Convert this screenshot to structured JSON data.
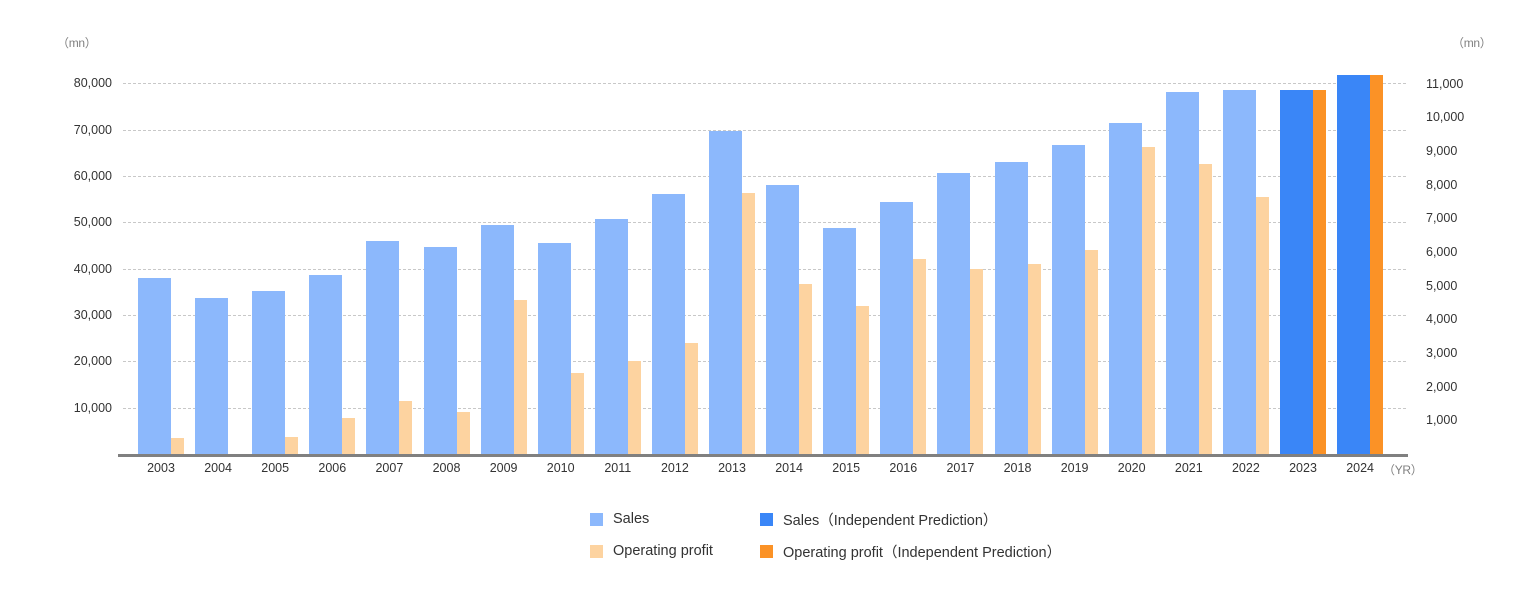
{
  "axes": {
    "left_unit": "（mn）",
    "right_unit": "（mn）",
    "x_unit": "（YR）",
    "left_ticks": [
      "80,000",
      "70,000",
      "60,000",
      "50,000",
      "40,000",
      "30,000",
      "20,000",
      "10,000"
    ],
    "right_ticks": [
      "11,000",
      "10,000",
      "9,000",
      "8,000",
      "7,000",
      "6,000",
      "5,000",
      "4,000",
      "3,000",
      "2,000",
      "1,000"
    ]
  },
  "legend": {
    "sales": "Sales",
    "sales_prediction": "Sales（Independent Prediction）",
    "operating_profit": "Operating profit",
    "operating_profit_prediction": "Operating profit（Independent Prediction）",
    "colors": {
      "sales": "#8cb8fc",
      "sales_prediction": "#3a86f7",
      "operating_profit": "#fdd3a0",
      "operating_profit_prediction": "#fb9226"
    }
  },
  "chart_data": {
    "type": "bar",
    "title": "",
    "xlabel": "（YR）",
    "ylabel": "（mn）",
    "y2label": "（mn）",
    "ylim": [
      0,
      85000
    ],
    "y2lim": [
      0,
      11700
    ],
    "grid": true,
    "legend_position": "bottom",
    "categories": [
      "2003",
      "2004",
      "2005",
      "2006",
      "2007",
      "2008",
      "2009",
      "2010",
      "2011",
      "2012",
      "2013",
      "2014",
      "2015",
      "2016",
      "2017",
      "2018",
      "2019",
      "2020",
      "2021",
      "2022",
      "2023",
      "2024"
    ],
    "series": [
      {
        "name": "Sales",
        "axis": "left",
        "unit": "mn",
        "values": [
          38000,
          33600,
          35100,
          38700,
          45900,
          44700,
          49500,
          45600,
          50700,
          56100,
          69700,
          58000,
          48700,
          54400,
          60600,
          62900,
          66700,
          71400,
          78100,
          78500,
          78500,
          81700
        ],
        "predicted_from": "2023"
      },
      {
        "name": "Operating profit",
        "axis": "right",
        "unit": "mn",
        "values": [
          480,
          0,
          510,
          1060,
          1580,
          1240,
          4560,
          2410,
          2760,
          3290,
          7750,
          5050,
          4400,
          5780,
          5500,
          5650,
          6060,
          9130,
          8620,
          7620,
          10800,
          11250
        ],
        "predicted_from": "2023"
      }
    ],
    "notes": "2004 operating profit not visible (≈0). 2023 and 2024 are independent predictions shown in saturated blue/orange."
  },
  "bars": [
    {
      "year": "2003",
      "sales": 38000,
      "profit": 480,
      "predicted": false
    },
    {
      "year": "2004",
      "sales": 33600,
      "profit": 0,
      "predicted": false
    },
    {
      "year": "2005",
      "sales": 35100,
      "profit": 510,
      "predicted": false
    },
    {
      "year": "2006",
      "sales": 38700,
      "profit": 1060,
      "predicted": false
    },
    {
      "year": "2007",
      "sales": 45900,
      "profit": 1580,
      "predicted": false
    },
    {
      "year": "2008",
      "sales": 44700,
      "profit": 1240,
      "predicted": false
    },
    {
      "year": "2009",
      "sales": 49500,
      "profit": 4560,
      "predicted": false
    },
    {
      "year": "2010",
      "sales": 45600,
      "profit": 2410,
      "predicted": false
    },
    {
      "year": "2011",
      "sales": 50700,
      "profit": 2760,
      "predicted": false
    },
    {
      "year": "2012",
      "sales": 56100,
      "profit": 3290,
      "predicted": false
    },
    {
      "year": "2013",
      "sales": 69700,
      "profit": 7750,
      "predicted": false
    },
    {
      "year": "2014",
      "sales": 58000,
      "profit": 5050,
      "predicted": false
    },
    {
      "year": "2015",
      "sales": 48700,
      "profit": 4400,
      "predicted": false
    },
    {
      "year": "2016",
      "sales": 54400,
      "profit": 5780,
      "predicted": false
    },
    {
      "year": "2017",
      "sales": 60600,
      "profit": 5500,
      "predicted": false
    },
    {
      "year": "2018",
      "sales": 62900,
      "profit": 5650,
      "predicted": false
    },
    {
      "year": "2019",
      "sales": 66700,
      "profit": 6060,
      "predicted": false
    },
    {
      "year": "2020",
      "sales": 71400,
      "profit": 9130,
      "predicted": false
    },
    {
      "year": "2021",
      "sales": 78100,
      "profit": 8620,
      "predicted": false
    },
    {
      "year": "2022",
      "sales": 78500,
      "profit": 7620,
      "predicted": false
    },
    {
      "year": "2023",
      "sales": 78500,
      "profit": 10800,
      "predicted": true
    },
    {
      "year": "2024",
      "sales": 81700,
      "profit": 11250,
      "predicted": true
    }
  ]
}
